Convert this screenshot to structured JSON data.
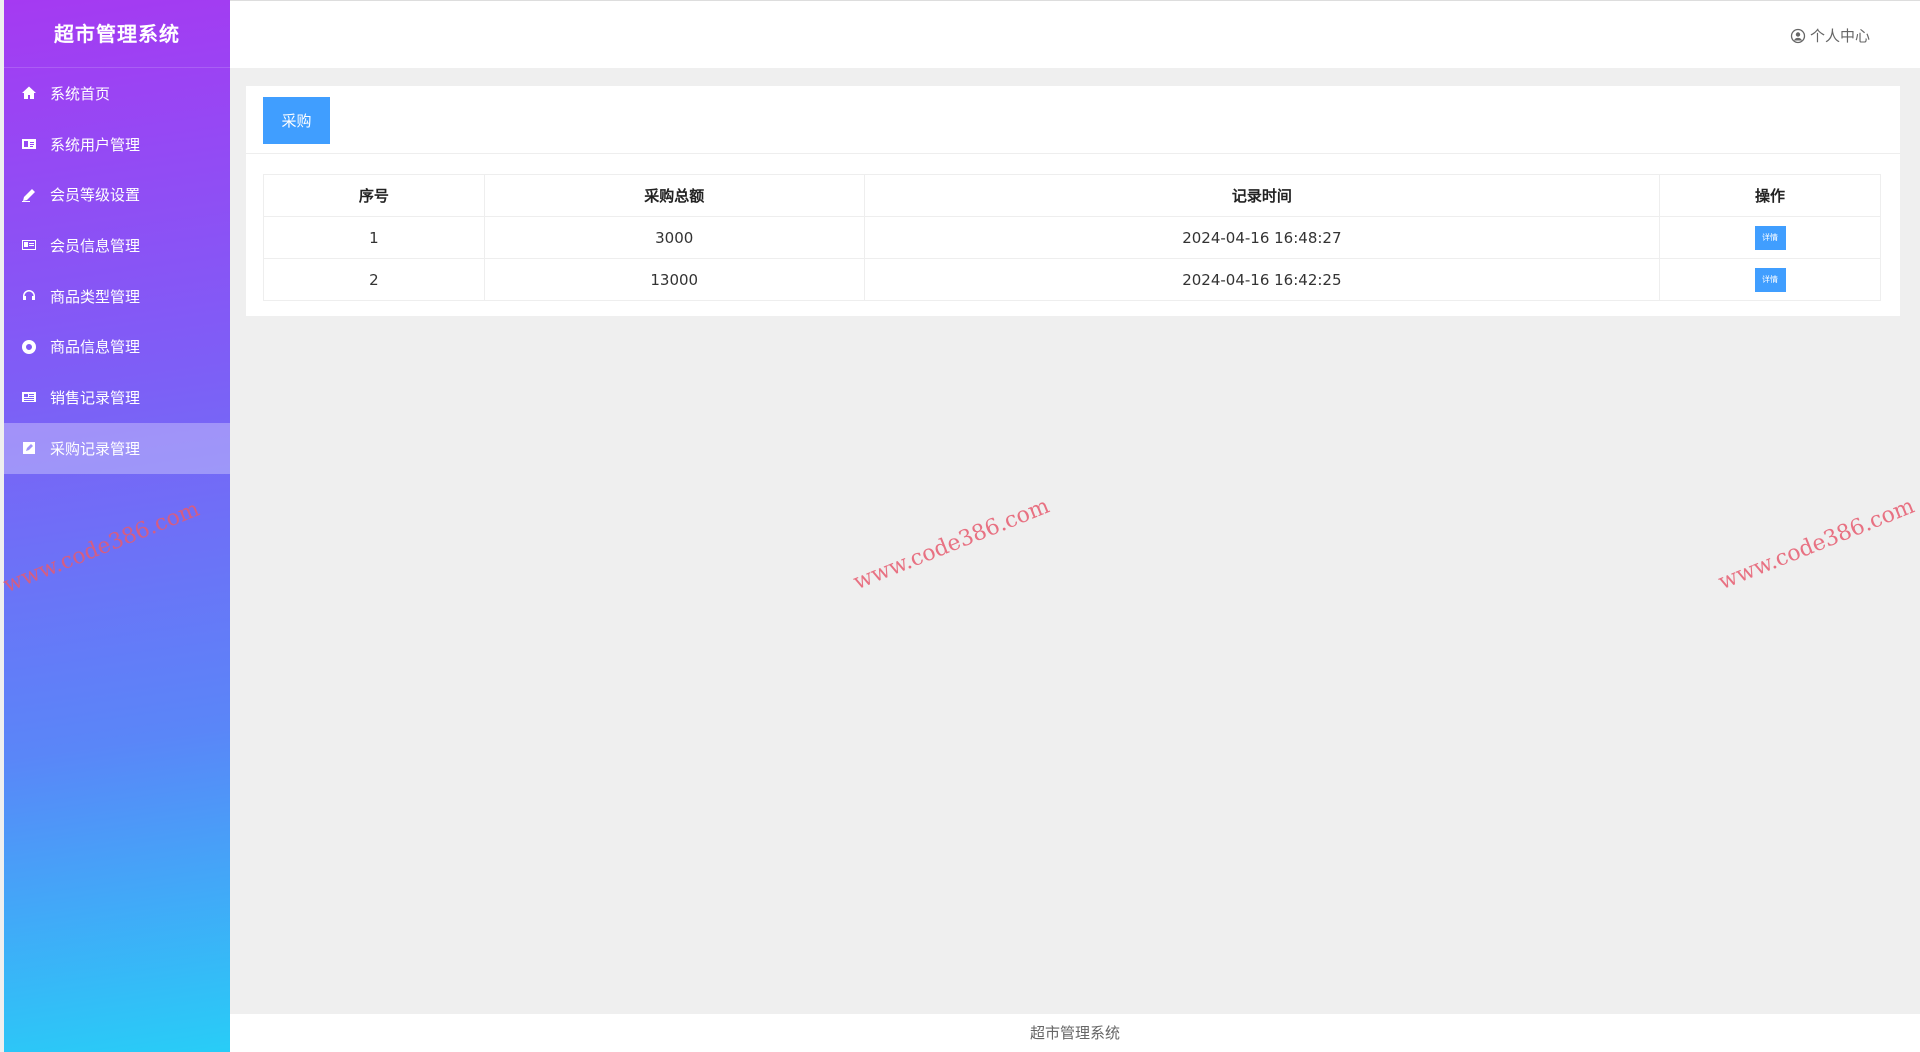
{
  "app": {
    "title": "超市管理系统",
    "user_center": "个人中心"
  },
  "sidebar": {
    "items": [
      {
        "label": "系统首页",
        "icon": "home-icon"
      },
      {
        "label": "系统用户管理",
        "icon": "id-card-icon"
      },
      {
        "label": "会员等级设置",
        "icon": "pencil-icon"
      },
      {
        "label": "会员信息管理",
        "icon": "address-card-icon"
      },
      {
        "label": "商品类型管理",
        "icon": "headset-icon"
      },
      {
        "label": "商品信息管理",
        "icon": "lifebuoy-icon"
      },
      {
        "label": "销售记录管理",
        "icon": "newspaper-icon"
      },
      {
        "label": "采购记录管理",
        "icon": "edit-icon",
        "active": true
      }
    ]
  },
  "toolbar": {
    "purchase_label": "采购"
  },
  "table": {
    "headers": [
      "序号",
      "采购总额",
      "记录时间",
      "操作"
    ],
    "rows": [
      {
        "index": "1",
        "total": "3000",
        "time": "2024-04-16 16:48:27",
        "action": "详情"
      },
      {
        "index": "2",
        "total": "13000",
        "time": "2024-04-16 16:42:25",
        "action": "详情"
      }
    ]
  },
  "watermark": "www.code386.com",
  "footer": {
    "text": "超市管理系统"
  },
  "colors": {
    "primary": "#409eff",
    "sidebar_top": "#a53af2",
    "sidebar_bottom": "#28cdf7"
  }
}
